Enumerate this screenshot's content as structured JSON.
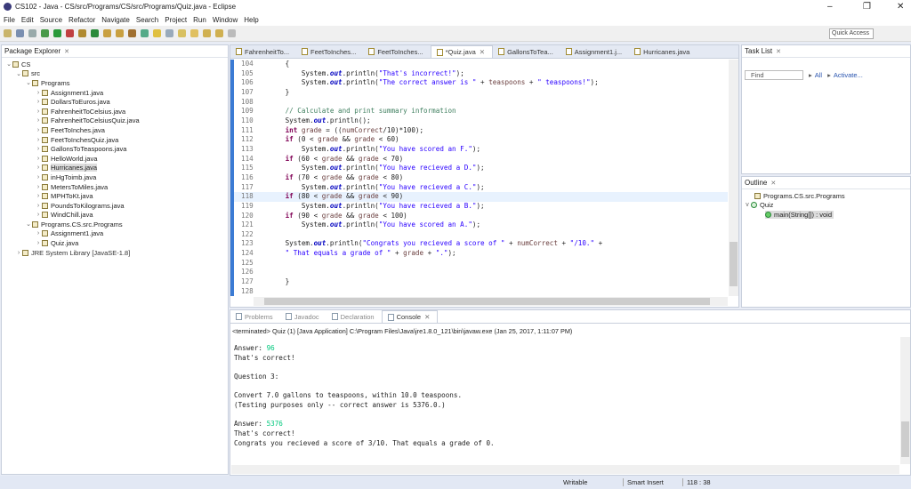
{
  "window": {
    "title": "CS102 - Java - CS/src/Programs/CS/src/Programs/Quiz.java - Eclipse"
  },
  "menu": [
    "File",
    "Edit",
    "Source",
    "Refactor",
    "Navigate",
    "Search",
    "Project",
    "Run",
    "Window",
    "Help"
  ],
  "quick_access": "Quick Access",
  "package_explorer": {
    "title": "Package Explorer",
    "items": [
      {
        "label": "CS",
        "depth": 0,
        "arrow": "v"
      },
      {
        "label": "src",
        "depth": 1,
        "arrow": "v"
      },
      {
        "label": "Programs",
        "depth": 2,
        "arrow": "v"
      },
      {
        "label": "Assignment1.java",
        "depth": 3,
        "arrow": ">"
      },
      {
        "label": "DollarsToEuros.java",
        "depth": 3,
        "arrow": ">"
      },
      {
        "label": "FahrenheitToCelsius.java",
        "depth": 3,
        "arrow": ">"
      },
      {
        "label": "FahrenheitToCelsiusQuiz.java",
        "depth": 3,
        "arrow": ">"
      },
      {
        "label": "FeetToInches.java",
        "depth": 3,
        "arrow": ">"
      },
      {
        "label": "FeetToInchesQuiz.java",
        "depth": 3,
        "arrow": ">"
      },
      {
        "label": "GallonsToTeaspoons.java",
        "depth": 3,
        "arrow": ">"
      },
      {
        "label": "HelloWorld.java",
        "depth": 3,
        "arrow": ">"
      },
      {
        "label": "Hurricanes.java",
        "depth": 3,
        "arrow": ">",
        "selected": true
      },
      {
        "label": "inHgToimb.java",
        "depth": 3,
        "arrow": ">"
      },
      {
        "label": "MetersToMiles.java",
        "depth": 3,
        "arrow": ">"
      },
      {
        "label": "MPHToKt.java",
        "depth": 3,
        "arrow": ">"
      },
      {
        "label": "PoundsToKilograms.java",
        "depth": 3,
        "arrow": ">"
      },
      {
        "label": "WindChill.java",
        "depth": 3,
        "arrow": ">"
      },
      {
        "label": "Programs.CS.src.Programs",
        "depth": 2,
        "arrow": "v"
      },
      {
        "label": "Assignment1.java",
        "depth": 3,
        "arrow": ">"
      },
      {
        "label": "Quiz.java",
        "depth": 3,
        "arrow": ">"
      },
      {
        "label": "JRE System Library [JavaSE-1.8]",
        "depth": 1,
        "arrow": ">"
      }
    ]
  },
  "editor": {
    "tabs": [
      "FahrenheitTo...",
      "FeetToInches...",
      "FeetToInches...",
      "*Quiz.java",
      "GallonsToTea...",
      "Assignment1.j...",
      "Hurricanes.java"
    ],
    "active_tab": 3,
    "current_line": "118",
    "lines": [
      {
        "n": "104",
        "t": [
          [
            "",
            "        {"
          ]
        ]
      },
      {
        "n": "105",
        "t": [
          [
            "",
            "            System."
          ],
          [
            "fld",
            "out"
          ],
          [
            "",
            ".println("
          ],
          [
            "str",
            "\"That's incorrect!\""
          ],
          [
            "",
            ");"
          ]
        ]
      },
      {
        "n": "106",
        "t": [
          [
            "",
            "            System."
          ],
          [
            "fld",
            "out"
          ],
          [
            "",
            ".println("
          ],
          [
            "str",
            "\"The correct answer is \""
          ],
          [
            "",
            " + "
          ],
          [
            "var",
            "teaspoons"
          ],
          [
            "",
            " + "
          ],
          [
            "str",
            "\" teaspoons!\""
          ],
          [
            "",
            ");"
          ]
        ]
      },
      {
        "n": "107",
        "t": [
          [
            "",
            "        }"
          ]
        ]
      },
      {
        "n": "108",
        "t": [
          [
            "",
            ""
          ]
        ]
      },
      {
        "n": "109",
        "t": [
          [
            "cmt",
            "        // Calculate and print summary information"
          ]
        ]
      },
      {
        "n": "110",
        "t": [
          [
            "",
            "        System."
          ],
          [
            "fld",
            "out"
          ],
          [
            "",
            ".println();"
          ]
        ]
      },
      {
        "n": "111",
        "t": [
          [
            "kw",
            "        int"
          ],
          [
            "",
            " "
          ],
          [
            "var",
            "grade"
          ],
          [
            "",
            " = (("
          ],
          [
            "var",
            "numCorrect"
          ],
          [
            "",
            "/10)*100);"
          ]
        ]
      },
      {
        "n": "112",
        "t": [
          [
            "kw",
            "        if"
          ],
          [
            "",
            " (0 < "
          ],
          [
            "var",
            "grade"
          ],
          [
            "",
            " && "
          ],
          [
            "var",
            "grade"
          ],
          [
            "",
            " < 60)"
          ]
        ]
      },
      {
        "n": "113",
        "t": [
          [
            "",
            "            System."
          ],
          [
            "fld",
            "out"
          ],
          [
            "",
            ".println("
          ],
          [
            "str",
            "\"You have scored an F.\""
          ],
          [
            "",
            ");"
          ]
        ]
      },
      {
        "n": "114",
        "t": [
          [
            "kw",
            "        if"
          ],
          [
            "",
            " (60 < "
          ],
          [
            "var",
            "grade"
          ],
          [
            "",
            " && "
          ],
          [
            "var",
            "grade"
          ],
          [
            "",
            " < 70)"
          ]
        ]
      },
      {
        "n": "115",
        "t": [
          [
            "",
            "            System."
          ],
          [
            "fld",
            "out"
          ],
          [
            "",
            ".println("
          ],
          [
            "str",
            "\"You have recieved a D.\""
          ],
          [
            "",
            ");"
          ]
        ]
      },
      {
        "n": "116",
        "t": [
          [
            "kw",
            "        if"
          ],
          [
            "",
            " (70 < "
          ],
          [
            "var",
            "grade"
          ],
          [
            "",
            " && "
          ],
          [
            "var",
            "grade"
          ],
          [
            "",
            " < 80)"
          ]
        ]
      },
      {
        "n": "117",
        "t": [
          [
            "",
            "            System."
          ],
          [
            "fld",
            "out"
          ],
          [
            "",
            ".println("
          ],
          [
            "str",
            "\"You have recieved a C.\""
          ],
          [
            "",
            ");"
          ]
        ]
      },
      {
        "n": "118",
        "t": [
          [
            "kw",
            "        if"
          ],
          [
            "",
            " (80 < "
          ],
          [
            "var",
            "grade"
          ],
          [
            "",
            " && "
          ],
          [
            "var",
            "grade"
          ],
          [
            "",
            " < 90)"
          ]
        ]
      },
      {
        "n": "119",
        "t": [
          [
            "",
            "            System."
          ],
          [
            "fld",
            "out"
          ],
          [
            "",
            ".println("
          ],
          [
            "str",
            "\"You have recieved a B.\""
          ],
          [
            "",
            ");"
          ]
        ]
      },
      {
        "n": "120",
        "t": [
          [
            "kw",
            "        if"
          ],
          [
            "",
            " (90 < "
          ],
          [
            "var",
            "grade"
          ],
          [
            "",
            " && "
          ],
          [
            "var",
            "grade"
          ],
          [
            "",
            " < 100)"
          ]
        ]
      },
      {
        "n": "121",
        "t": [
          [
            "",
            "            System."
          ],
          [
            "fld",
            "out"
          ],
          [
            "",
            ".println("
          ],
          [
            "str",
            "\"You have scored an A.\""
          ],
          [
            "",
            ");"
          ]
        ]
      },
      {
        "n": "122",
        "t": [
          [
            "",
            ""
          ]
        ]
      },
      {
        "n": "123",
        "t": [
          [
            "",
            "        System."
          ],
          [
            "fld",
            "out"
          ],
          [
            "",
            ".println("
          ],
          [
            "str",
            "\"Congrats you recieved a score of \""
          ],
          [
            "",
            " + "
          ],
          [
            "var",
            "numCorrect"
          ],
          [
            "",
            " + "
          ],
          [
            "str",
            "\"/10.\""
          ],
          [
            "",
            " +"
          ]
        ]
      },
      {
        "n": "124",
        "t": [
          [
            "str",
            "        \" That equals a grade of \""
          ],
          [
            "",
            " + "
          ],
          [
            "var",
            "grade"
          ],
          [
            "",
            " + "
          ],
          [
            "str",
            "\".\""
          ],
          [
            "",
            ");"
          ]
        ]
      },
      {
        "n": "125",
        "t": [
          [
            "",
            ""
          ]
        ]
      },
      {
        "n": "126",
        "t": [
          [
            "",
            ""
          ]
        ]
      },
      {
        "n": "127",
        "t": [
          [
            "",
            "        }"
          ]
        ]
      },
      {
        "n": "128",
        "t": [
          [
            "",
            ""
          ]
        ]
      }
    ]
  },
  "task_list": {
    "title": "Task List",
    "find_placeholder": "Find",
    "all": "All",
    "activate": "Activate..."
  },
  "outline": {
    "title": "Outline",
    "items": [
      "Programs.CS.src.Programs",
      "Quiz",
      "main(String[]) : void"
    ]
  },
  "bottom": {
    "tabs": [
      "Problems",
      "Javadoc",
      "Declaration",
      "Console"
    ],
    "active_tab": 3,
    "terminated": "<terminated> Quiz (1) [Java Application] C:\\Program Files\\Java\\jre1.8.0_121\\bin\\javaw.exe (Jan 25, 2017, 1:11:07 PM)",
    "lines": [
      [
        [
          "",
          "Answer: "
        ],
        [
          "inp",
          "96"
        ]
      ],
      [
        [
          "",
          "That's correct!"
        ]
      ],
      [
        [
          "",
          ""
        ]
      ],
      [
        [
          "",
          "Question 3:"
        ]
      ],
      [
        [
          "",
          ""
        ]
      ],
      [
        [
          "",
          "Convert 7.0 gallons to teaspoons, within 10.0 teaspoons."
        ]
      ],
      [
        [
          "",
          "(Testing purposes only -- correct answer is 5376.0.)"
        ]
      ],
      [
        [
          "",
          ""
        ]
      ],
      [
        [
          "",
          "Answer: "
        ],
        [
          "inp",
          "5376"
        ]
      ],
      [
        [
          "",
          "That's correct!"
        ]
      ],
      [
        [
          "",
          "Congrats you recieved a score of 3/10. That equals a grade of 0."
        ]
      ]
    ]
  },
  "status": {
    "writable": "Writable",
    "insert_mode": "Smart Insert",
    "position": "118 : 38"
  }
}
